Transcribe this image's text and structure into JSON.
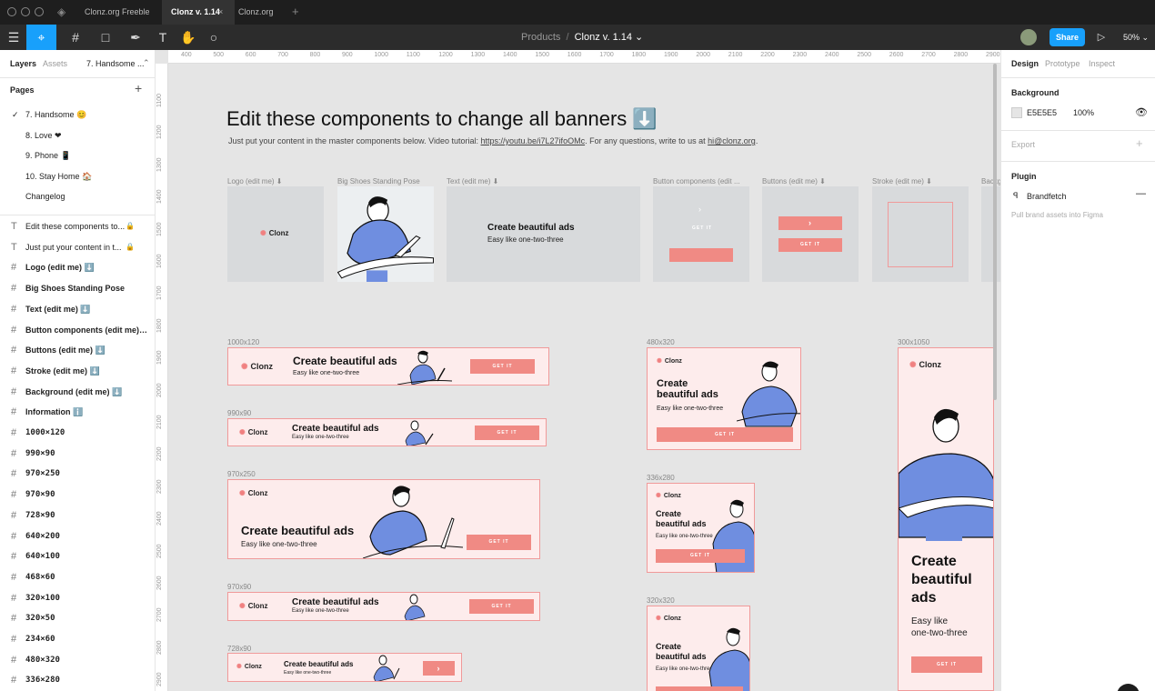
{
  "tabs": [
    "Clonz.org Freeble",
    "Clonz v. 1.14",
    "Clonz.org"
  ],
  "toolbar": {
    "breadcrumb_parent": "Products",
    "breadcrumb_sep": "/",
    "file_name": "Clonz v. 1.14 ⌄",
    "share": "Share",
    "zoom": "50% ⌄"
  },
  "left": {
    "tab_layers": "Layers",
    "tab_assets": "Assets",
    "page_selector": "7. Handsome ...",
    "pages_header": "Pages",
    "pages": [
      "7. Handsome 😊",
      "8. Love ❤",
      "9. Phone 📱",
      "10. Stay Home 🏠",
      "Changelog"
    ],
    "layers": [
      {
        "icon": "T",
        "label": "Edit these components to..."
      },
      {
        "icon": "T",
        "label": "Just put your content in t..."
      },
      {
        "icon": "#",
        "label": "Logo (edit me) ⬇️"
      },
      {
        "icon": "#",
        "label": "Big Shoes Standing Pose"
      },
      {
        "icon": "#",
        "label": "Text (edit me) ⬇️"
      },
      {
        "icon": "#",
        "label": "Button components (edit me) ⬇️"
      },
      {
        "icon": "#",
        "label": "Buttons (edit me) ⬇️"
      },
      {
        "icon": "#",
        "label": "Stroke (edit me) ⬇️"
      },
      {
        "icon": "#",
        "label": "Background (edit me) ⬇️"
      },
      {
        "icon": "#",
        "label": "Information ℹ️"
      },
      {
        "icon": "#",
        "label": "1000×120"
      },
      {
        "icon": "#",
        "label": "990×90"
      },
      {
        "icon": "#",
        "label": "970×250"
      },
      {
        "icon": "#",
        "label": "970×90"
      },
      {
        "icon": "#",
        "label": "728×90"
      },
      {
        "icon": "#",
        "label": "640×200"
      },
      {
        "icon": "#",
        "label": "640×100"
      },
      {
        "icon": "#",
        "label": "468×60"
      },
      {
        "icon": "#",
        "label": "320×100"
      },
      {
        "icon": "#",
        "label": "320×50"
      },
      {
        "icon": "#",
        "label": "234×60"
      },
      {
        "icon": "#",
        "label": "480×320"
      },
      {
        "icon": "#",
        "label": "336×280"
      }
    ]
  },
  "ruler": {
    "top": [
      "400",
      "500",
      "600",
      "700",
      "800",
      "900",
      "1000",
      "1100",
      "1200",
      "1300",
      "1400",
      "1500",
      "1600",
      "1700",
      "1800",
      "1900",
      "2000",
      "2100",
      "2200",
      "2300",
      "2400",
      "2500",
      "2600",
      "2700",
      "2800",
      "2900"
    ],
    "left": [
      "1100",
      "1200",
      "1300",
      "1400",
      "1500",
      "1600",
      "1700",
      "1800",
      "1900",
      "2000",
      "2100",
      "2200",
      "2300",
      "2400",
      "2500",
      "2600",
      "2700",
      "2800",
      "2900"
    ]
  },
  "canvas": {
    "heading": "Edit these components to change all banners ⬇️",
    "sub_prefix": "Just put your content in the master components below. Video tutorial: ",
    "sub_link": "https://youtu.be/i7L27ifoOMc",
    "sub_mid": ". For any questions, write to us at ",
    "sub_mail": "hi@clonz.org",
    "sub_end": ".",
    "comp_labels": [
      "Logo (edit me) ⬇",
      "Big Shoes Standing Pose",
      "Text (edit me) ⬇",
      "Button components (edit ...",
      "Buttons (edit me) ⬇",
      "Stroke (edit me) ⬇",
      "Backg"
    ],
    "logo": "Clonz",
    "headline": "Create beautiful ads",
    "tagline": "Easy like one-two-three",
    "cta": "GET IT",
    "arrow": "›",
    "sizes": [
      "1000x120",
      "990x90",
      "970x250",
      "970x90",
      "728x90",
      "480x320",
      "336x280",
      "320x320",
      "300x1050"
    ],
    "tall_headline": [
      "Create",
      "beautiful",
      "ads"
    ],
    "tall_tagline": [
      "Easy like",
      "one-two-three"
    ],
    "mid_headline": [
      "Create",
      "beautiful ads"
    ]
  },
  "right": {
    "tab_design": "Design",
    "tab_prototype": "Prototype",
    "tab_inspect": "Inspect",
    "bg_title": "Background",
    "bg_hex": "E5E5E5",
    "bg_opacity": "100%",
    "export": "Export",
    "plugin": "Plugin",
    "plugin_name": "Brandfetch",
    "plugin_desc": "Pull brand assets into Figma"
  },
  "colors": {
    "accent": "#f08a84",
    "banner_bg": "#fdecec",
    "canvas": "#e5e5e5",
    "figma_blue": "#18a0fb",
    "shirt": "#6f8ee0"
  }
}
